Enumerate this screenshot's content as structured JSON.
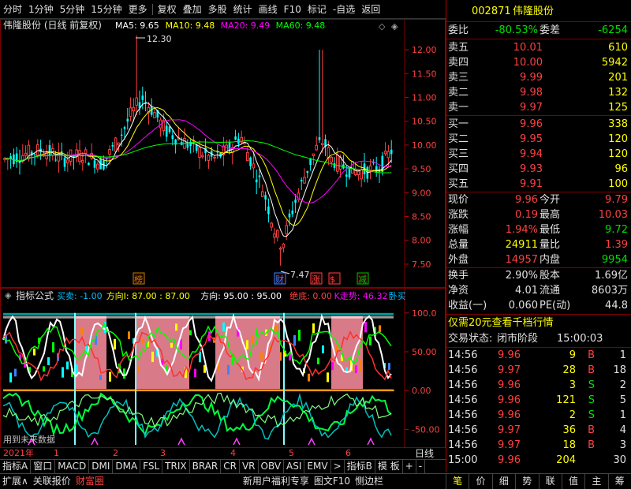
{
  "toolbar": {
    "items": [
      "分时",
      "1分钟",
      "5分钟",
      "15分钟",
      "更多",
      "复权",
      "叠加",
      "多股",
      "统计",
      "画线",
      "F10",
      "标记",
      "-自选",
      "返回"
    ]
  },
  "main": {
    "title": "伟隆股份 (日线 前复权)",
    "ma": [
      {
        "label": "MA5: 9.65",
        "color": "#ffffff"
      },
      {
        "label": "MA10: 9.48",
        "color": "#ffff00"
      },
      {
        "label": "MA20: 9.49",
        "color": "#ff00ff"
      },
      {
        "label": "MA60: 9.48",
        "color": "#00ff00"
      }
    ],
    "y_ticks": [
      "12.00",
      "11.50",
      "11.00",
      "10.50",
      "10.00",
      "9.50",
      "9.00",
      "8.50",
      "8.00",
      "7.50"
    ],
    "high_label": "12.30",
    "low_label": "7.47",
    "markers": [
      {
        "text": "榜",
        "color": "#c08000"
      },
      {
        "text": "财",
        "color": "#4080ff"
      },
      {
        "text": "涨",
        "color": "#ff4040"
      },
      {
        "text": "$",
        "color": "#ff4040"
      },
      {
        "text": "减",
        "color": "#00c000"
      }
    ]
  },
  "indicator": {
    "title": "指标公式",
    "fields": [
      {
        "label": "买卖",
        "value": "-1.00",
        "color": "#00c0ff"
      },
      {
        "label": "方向I",
        "value": "87.00 : 87.00",
        "color": "#ffff00"
      },
      {
        "label": "方向",
        "value": "95.00 : 95.00",
        "color": "#ffffff"
      },
      {
        "label": "绝底",
        "value": "0.00",
        "color": "#ff4040"
      },
      {
        "label": "K走势",
        "value": "46.32",
        "color": "#ff00ff"
      },
      {
        "label": "卧买",
        "value": "",
        "color": "#00c0ff"
      }
    ],
    "y_ticks": [
      "100.0",
      "50.00",
      "0.00",
      "-50.00"
    ],
    "warning": "用到未来数据"
  },
  "xaxis": {
    "labels": [
      "2021年",
      "1",
      "2",
      "3",
      "4",
      "5",
      "6"
    ],
    "period": "日线"
  },
  "tabs1": [
    "指标A",
    "窗口",
    "MACD",
    "DMI",
    "DMA",
    "FSL",
    "TRIX",
    "BRAR",
    "CR",
    "VR",
    "OBV",
    "ASI",
    "EMV",
    ">",
    "指标B",
    "模 板",
    "+",
    "-"
  ],
  "tabs2": [
    "扩展∧",
    "关联报价",
    "财富圈",
    "新用户福利专享",
    "图文F10",
    "恻边栏"
  ],
  "rtabs": [
    "笔",
    "价",
    "细",
    "势",
    "联",
    "值",
    "主",
    "筹"
  ],
  "quote": {
    "code": "002871",
    "name": "伟隆股份",
    "weibi_label": "委比",
    "weibi": "-80.53%",
    "weicha_label": "委差",
    "weicha": "-6254",
    "sell": [
      {
        "label": "卖五",
        "price": "10.01",
        "vol": "610"
      },
      {
        "label": "卖四",
        "price": "10.00",
        "vol": "5942"
      },
      {
        "label": "卖三",
        "price": "9.99",
        "vol": "201"
      },
      {
        "label": "卖二",
        "price": "9.98",
        "vol": "132"
      },
      {
        "label": "卖一",
        "price": "9.97",
        "vol": "125"
      }
    ],
    "buy": [
      {
        "label": "买一",
        "price": "9.96",
        "vol": "338"
      },
      {
        "label": "买二",
        "price": "9.95",
        "vol": "120"
      },
      {
        "label": "买三",
        "price": "9.94",
        "vol": "120"
      },
      {
        "label": "买四",
        "price": "9.93",
        "vol": "96"
      },
      {
        "label": "买五",
        "price": "9.91",
        "vol": "100"
      }
    ],
    "stats": [
      {
        "l1": "现价",
        "v1": "9.96",
        "c1": "#ff4040",
        "l2": "今开",
        "v2": "9.79",
        "c2": "#ff4040"
      },
      {
        "l1": "涨跌",
        "v1": "0.19",
        "c1": "#ff4040",
        "l2": "最高",
        "v2": "10.03",
        "c2": "#ff4040"
      },
      {
        "l1": "涨幅",
        "v1": "1.94%",
        "c1": "#ff4040",
        "l2": "最低",
        "v2": "9.72",
        "c2": "#00e000"
      },
      {
        "l1": "总量",
        "v1": "24911",
        "c1": "#ffff00",
        "l2": "量比",
        "v2": "1.39",
        "c2": "#ff4040"
      },
      {
        "l1": "外盘",
        "v1": "14957",
        "c1": "#ff4040",
        "l2": "内盘",
        "v2": "9954",
        "c2": "#00e000"
      }
    ],
    "stats2": [
      {
        "l1": "换手",
        "v1": "2.90%",
        "l2": "股本",
        "v2": "1.69亿"
      },
      {
        "l1": "净资",
        "v1": "4.01",
        "l2": "流通",
        "v2": "8603万"
      },
      {
        "l1": "收益(一)",
        "v1": "0.060",
        "l2": "PE(动)",
        "v2": "44.8"
      }
    ],
    "promo": "仅需20元查看千档行情",
    "status_label": "交易状态:",
    "status": "闭市阶段",
    "status_time": "15:00:03",
    "ticks": [
      {
        "t": "14:56",
        "p": "9.96",
        "v": "9",
        "bs": "B",
        "n": "1"
      },
      {
        "t": "14:56",
        "p": "9.97",
        "v": "28",
        "bs": "B",
        "n": "18"
      },
      {
        "t": "14:56",
        "p": "9.96",
        "v": "3",
        "bs": "S",
        "n": "2"
      },
      {
        "t": "14:56",
        "p": "9.96",
        "v": "121",
        "bs": "S",
        "n": "5"
      },
      {
        "t": "14:56",
        "p": "9.96",
        "v": "2",
        "bs": "S",
        "n": "1"
      },
      {
        "t": "14:56",
        "p": "9.97",
        "v": "36",
        "bs": "B",
        "n": "4"
      },
      {
        "t": "14:56",
        "p": "9.97",
        "v": "18",
        "bs": "B",
        "n": "3"
      },
      {
        "t": "15:00",
        "p": "9.96",
        "v": "204",
        "bs": "",
        "n": "30"
      }
    ]
  },
  "colors": {
    "up": "#ff4040",
    "down": "#00ffff",
    "grid": "#800000"
  }
}
